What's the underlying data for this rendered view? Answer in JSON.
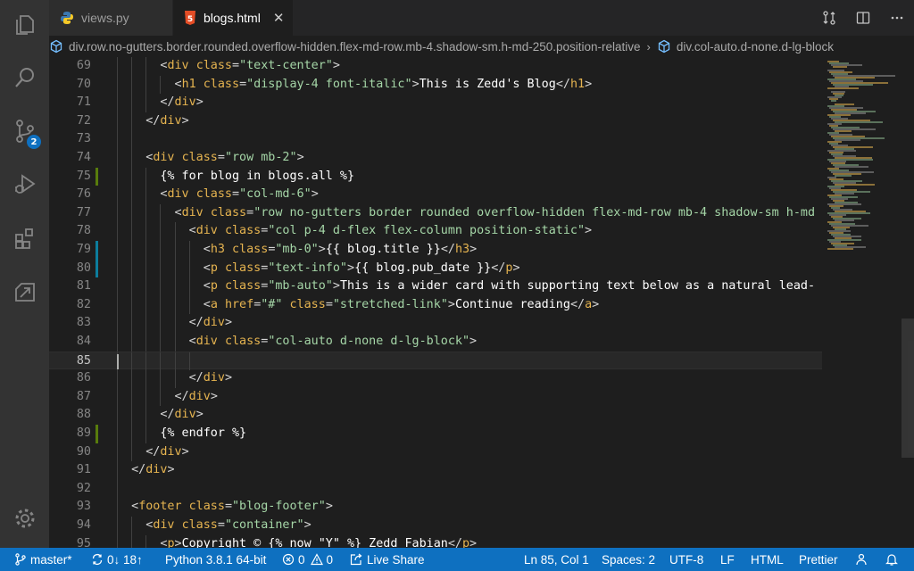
{
  "tabs": [
    {
      "label": "views.py",
      "icon": "python-icon",
      "active": false
    },
    {
      "label": "blogs.html",
      "icon": "html5-icon",
      "active": true
    }
  ],
  "tab_actions": [
    "compare-changes-icon",
    "split-editor-icon",
    "more-actions-icon"
  ],
  "breadcrumb": [
    "div.row.no-gutters.border.rounded.overflow-hidden.flex-md-row.mb-4.shadow-sm.h-md-250.position-relative",
    "div.col-auto.d-none.d-lg-block"
  ],
  "activity_bar": {
    "items": [
      "explorer-icon",
      "search-icon",
      "source-control-icon",
      "run-debug-icon",
      "extensions-icon",
      "remote-explorer-icon"
    ],
    "source_control_badge": "2",
    "settings": "gear-icon"
  },
  "editor": {
    "current_line": 85,
    "lines": [
      {
        "n": "69",
        "text": "      <div class=\"text-center\">"
      },
      {
        "n": "70",
        "text": "        <h1 class=\"display-4 font-italic\">This is Zedd's Blog</h1>"
      },
      {
        "n": "71",
        "text": "      </div>"
      },
      {
        "n": "72",
        "text": "    </div>"
      },
      {
        "n": "73",
        "text": ""
      },
      {
        "n": "74",
        "text": "    <div class=\"row mb-2\">"
      },
      {
        "n": "75",
        "text": "      {% for blog in blogs.all %}"
      },
      {
        "n": "76",
        "text": "      <div class=\"col-md-6\">"
      },
      {
        "n": "77",
        "text": "        <div class=\"row no-gutters border rounded overflow-hidden flex-md-row mb-4 shadow-sm h-md"
      },
      {
        "n": "78",
        "text": "          <div class=\"col p-4 d-flex flex-column position-static\">"
      },
      {
        "n": "79",
        "text": "            <h3 class=\"mb-0\">{{ blog.title }}</h3>"
      },
      {
        "n": "80",
        "text": "            <p class=\"text-info\">{{ blog.pub_date }}</p>"
      },
      {
        "n": "81",
        "text": "            <p class=\"mb-auto\">This is a wider card with supporting text below as a natural lead-"
      },
      {
        "n": "82",
        "text": "            <a href=\"#\" class=\"stretched-link\">Continue reading</a>"
      },
      {
        "n": "83",
        "text": "          </div>"
      },
      {
        "n": "84",
        "text": "          <div class=\"col-auto d-none d-lg-block\">"
      },
      {
        "n": "85",
        "text": ""
      },
      {
        "n": "86",
        "text": "          </div>"
      },
      {
        "n": "87",
        "text": "        </div>"
      },
      {
        "n": "88",
        "text": "      </div>"
      },
      {
        "n": "89",
        "text": "      {% endfor %}"
      },
      {
        "n": "90",
        "text": "    </div>"
      },
      {
        "n": "91",
        "text": "  </div>"
      },
      {
        "n": "92",
        "text": ""
      },
      {
        "n": "93",
        "text": "  <footer class=\"blog-footer\">"
      },
      {
        "n": "94",
        "text": "    <div class=\"container\">"
      },
      {
        "n": "95",
        "text": "      <p>Copyright © {% now \"Y\" %} Zedd Fabian</p>"
      }
    ],
    "modified_lines": [
      {
        "n": "75",
        "kind": "added"
      },
      {
        "n": "79",
        "kind": "modified"
      },
      {
        "n": "80",
        "kind": "modified"
      },
      {
        "n": "89",
        "kind": "added"
      }
    ]
  },
  "statusbar": {
    "branch": "master*",
    "sync": "0↓ 18↑",
    "python": "Python 3.8.1 64-bit",
    "errors": "0",
    "warnings": "0",
    "live_share": "Live Share",
    "position": "Ln 85, Col 1",
    "spaces": "Spaces: 2",
    "encoding": "UTF-8",
    "eol": "LF",
    "language": "HTML",
    "formatter": "Prettier"
  },
  "colors": {
    "statusbar": "#0e70c0",
    "activitybar": "#333333",
    "editor_bg": "#1e1e1e",
    "tag": "#e6b450",
    "string": "#a5d6a7",
    "added_gutter": "#587c0c",
    "modified_gutter": "#0c7d9d"
  }
}
